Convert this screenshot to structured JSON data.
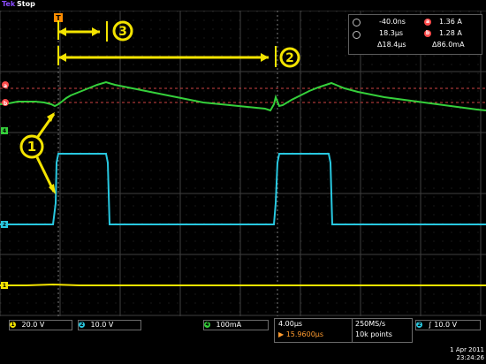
{
  "header": {
    "brand": "Tek",
    "run_state": "Stop"
  },
  "screen": {
    "channel_markers": {
      "ch1": "1",
      "ch2": "2",
      "ch4": "4"
    },
    "trigger_marker": "T",
    "cursor_markers": {
      "a": "a",
      "b": "b"
    },
    "annotations": {
      "callout_1": "1",
      "callout_2": "2",
      "callout_3": "3"
    }
  },
  "measurements": {
    "time_a": "-40.0ns",
    "time_b": "18.3µs",
    "delta_time": "Δ18.4µs",
    "amp_a": "1.36 A",
    "amp_b": "1.28 A",
    "delta_amp": "Δ86.0mA",
    "labels": {
      "a": "a",
      "b": "b"
    }
  },
  "bottom": {
    "ch1_label": "1",
    "ch1_value": "20.0 V",
    "ch2_label": "2",
    "ch2_value": "10.0 V",
    "ch4_label": "4",
    "ch4_value": "100mA",
    "timebase": "4.00µs",
    "trigger_pos": "15.9600µs",
    "sample_rate": "250MS/s",
    "record_length": "10k points",
    "trigger_channel": "2",
    "trigger_slope": "∫",
    "trigger_level": "10.0 V",
    "date_line1": "1 Apr 2011",
    "date_line2": "23:24:26"
  },
  "colors": {
    "ch1": "#f4e400",
    "ch2": "#28c8e0",
    "ch4": "#35d03b",
    "cursor_red": "#ff4b4b",
    "grid": "#4b4b4b",
    "annotation": "#f4e400"
  }
}
